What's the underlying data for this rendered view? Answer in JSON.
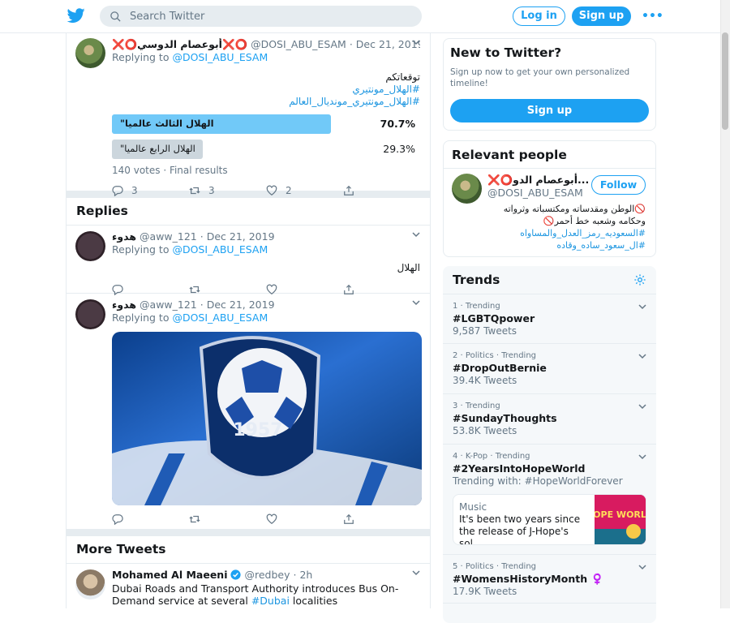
{
  "topbar": {
    "search_placeholder": "Search Twitter",
    "login_label": "Log in",
    "signup_label": "Sign up",
    "more_label": "•••"
  },
  "colors": {
    "accent": "#1da1f2",
    "divider": "#e6ecf0",
    "muted": "#657786"
  },
  "main_tweet": {
    "name": "❌⭕️أبوعصام الدوسي❌⭕️",
    "handle": "@DOSI_ABU_ESAM",
    "date": "Dec 21, 2019",
    "reply_prefix": "Replying to",
    "reply_handle": "@DOSI_ABU_ESAM",
    "text_line1": "توقعاتكم",
    "hashtag1": "#الهلال_مونتيري",
    "hashtag2": "#الهلال_مونتيري_مونديال_العالم",
    "poll": {
      "options": [
        {
          "label": "الهلال  الثالث عالميا\"",
          "percent": "70.7%",
          "fraction": 0.707
        },
        {
          "label": "الهلال الرابع عالميا\"",
          "percent": "29.3%",
          "fraction": 0.293
        }
      ],
      "meta": "140 votes · Final results"
    },
    "reply_count": "3",
    "retweet_count": "3",
    "like_count": "2"
  },
  "replies_heading": "Replies",
  "replies": [
    {
      "name": "هدوء",
      "handle": "@aww_121",
      "date": "Dec 21, 2019",
      "reply_prefix": "Replying to",
      "reply_handle": "@DOSI_ABU_ESAM",
      "text": "الهلال"
    },
    {
      "name": "هدوء",
      "handle": "@aww_121",
      "date": "Dec 21, 2019",
      "reply_prefix": "Replying to",
      "reply_handle": "@DOSI_ABU_ESAM",
      "image_text": "1957"
    }
  ],
  "more_tweets_heading": "More Tweets",
  "more_tweet": {
    "name": "Mohamed Al Maeeni",
    "handle": "@redbey",
    "time": "2h",
    "text_before": "Dubai Roads and Transport Authority introduces Bus On-Demand service at several",
    "hashtag": "#Dubai",
    "text_after": "localities"
  },
  "signup_box": {
    "title": "New to Twitter?",
    "description": "Sign up now to get your own personalized timeline!",
    "button": "Sign up"
  },
  "relevant_people": {
    "title": "Relevant people",
    "name": "❌⭕️أبوعصام الدو...",
    "handle": "@DOSI_ABU_ESAM",
    "follow_label": "Follow",
    "bio_line1": "🚫الوطن ومقدساته ومكتسباته وثرواته",
    "bio_line2": "وحكامه وشعبه خط أحمر🚫",
    "bio_tag1": "#السعوديه_رمز_العدل_والمساواه",
    "bio_tag2": "#ال_سعود_ساده_وقاده"
  },
  "trends": {
    "title": "Trends",
    "items": [
      {
        "meta": "1 · Trending",
        "name": "#LGBTQpower",
        "count": "9,587 Tweets"
      },
      {
        "meta": "2 · Politics · Trending",
        "name": "#DropOutBernie",
        "count": "39.4K Tweets"
      },
      {
        "meta": "3 · Trending",
        "name": "#SundayThoughts",
        "count": "53.8K Tweets"
      },
      {
        "meta": "4 · K-Pop · Trending",
        "name": "#2YearsIntoHopeWorld",
        "count": "Trending with: #HopeWorldForever",
        "card": {
          "category": "Music",
          "text": "It's been two years since the release of J-Hope's sol...",
          "image_text": "HOPE WORLD"
        }
      },
      {
        "meta": "5 · Politics · Trending",
        "name": "#WomensHistoryMonth ♀️",
        "count": "17.9K Tweets"
      }
    ]
  }
}
